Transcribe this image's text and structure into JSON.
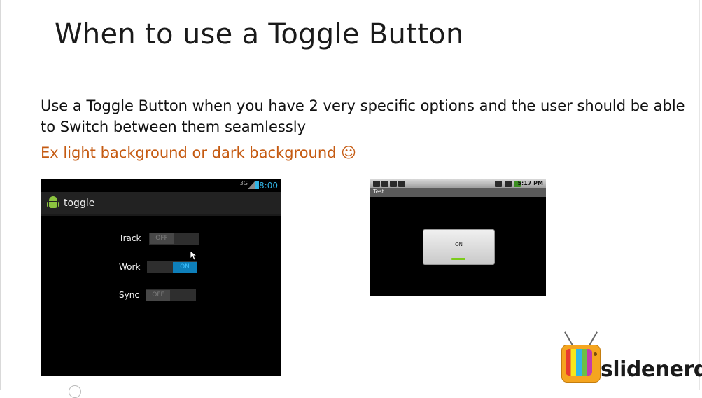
{
  "slide": {
    "title": "When to use a Toggle Button",
    "body": "Use a Toggle Button when you have 2 very specific options and the user should be able to Switch between them seamlessly",
    "example": "Ex light background or dark background ☺"
  },
  "phone1": {
    "status": {
      "signal_label": "3G",
      "time": "8:00"
    },
    "app_title": "toggle",
    "rows": [
      {
        "label": "Track",
        "state": "OFF"
      },
      {
        "label": "Work",
        "state": "ON"
      },
      {
        "label": "Sync",
        "state": "OFF"
      }
    ]
  },
  "phone2": {
    "status": {
      "time": "5:17 PM"
    },
    "app_title": "Test",
    "toggle_label": "ON"
  },
  "logo": {
    "text": "slidenerd"
  },
  "colors": {
    "accent_orange": "#c55a11",
    "holo_blue": "#33b5e5",
    "indicator_green": "#7ccb1c"
  }
}
